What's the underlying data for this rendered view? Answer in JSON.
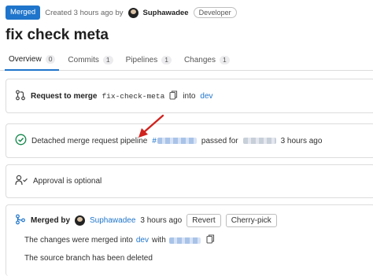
{
  "header": {
    "status_badge": "Merged",
    "created_text": "Created 3 hours ago by",
    "author": "Suphawadee",
    "role": "Developer"
  },
  "title": "fix check meta",
  "tabs": [
    {
      "label": "Overview",
      "count": "0",
      "active": true
    },
    {
      "label": "Commits",
      "count": "1"
    },
    {
      "label": "Pipelines",
      "count": "1"
    },
    {
      "label": "Changes",
      "count": "1"
    }
  ],
  "merge_request": {
    "prefix": "Request to merge",
    "source_branch": "fix-check-meta",
    "into": "into",
    "target_branch": "dev"
  },
  "pipeline": {
    "text": "Detached merge request pipeline",
    "hash_symbol": "#",
    "passed_for": "passed for",
    "time": "3 hours ago"
  },
  "approval": {
    "text": "Approval is optional"
  },
  "merged": {
    "prefix": "Merged by",
    "author": "Suphawadee",
    "time": "3 hours ago",
    "revert_label": "Revert",
    "cherry_pick_label": "Cherry-pick",
    "merged_into_text": "The changes were merged into",
    "branch": "dev",
    "with": "with",
    "deleted_text": "The source branch has been deleted"
  },
  "colors": {
    "accent": "#1f75cb",
    "success": "#108548",
    "annotation_arrow": "#d0231f"
  }
}
